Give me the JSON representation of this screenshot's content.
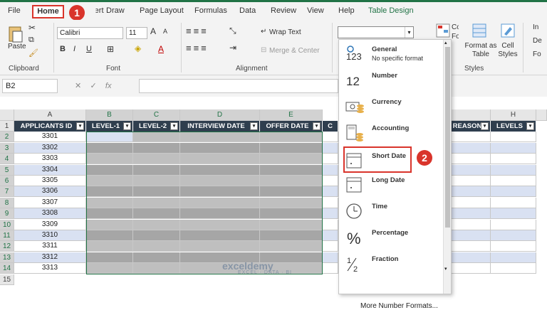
{
  "tabs": [
    "File",
    "Home",
    "Insert",
    "Draw",
    "Page Layout",
    "Formulas",
    "Data",
    "Review",
    "View",
    "Help",
    "Table Design"
  ],
  "annotations": {
    "step1": "1",
    "step2": "2"
  },
  "ribbon": {
    "clipboard": {
      "paste": "Paste",
      "label": "Clipboard"
    },
    "font": {
      "name": "Calibri",
      "size": "11",
      "label": "Font",
      "bold": "B",
      "italic": "I",
      "underline": "U",
      "increase": "A",
      "decrease": "A"
    },
    "alignment": {
      "wrap": "Wrap Text",
      "merge": "Merge & Center",
      "label": "Alignment"
    },
    "styles": {
      "conditional": "Conditional Formatting",
      "format_as_table": "Format as Table",
      "cell_styles": "Cell Styles",
      "label": "Styles"
    },
    "cells": {
      "insert": "In",
      "delete": "De",
      "format": "Fo"
    }
  },
  "formula_bar": {
    "name_box": "B2",
    "fx": "fx"
  },
  "grid": {
    "columns": [
      "A",
      "B",
      "C",
      "D",
      "E",
      "H"
    ],
    "headers": [
      "APPLICANTS ID",
      "LEVEL-1",
      "LEVEL-2",
      "INTERVIEW DATE",
      "OFFER DATE",
      "C",
      "REASON",
      "LEVELS"
    ],
    "row_numbers": [
      "1",
      "2",
      "3",
      "4",
      "5",
      "6",
      "7",
      "8",
      "9",
      "10",
      "11",
      "12",
      "13",
      "14",
      "15"
    ],
    "ids": [
      "3301",
      "3302",
      "3303",
      "3304",
      "3305",
      "3306",
      "3307",
      "3308",
      "3309",
      "3310",
      "3311",
      "3312",
      "3313"
    ]
  },
  "number_format_menu": {
    "items": [
      {
        "title": "General",
        "sub": "No specific format",
        "icon": "general-123-icon"
      },
      {
        "title": "Number",
        "sub": "",
        "icon": "number-12-icon"
      },
      {
        "title": "Currency",
        "sub": "",
        "icon": "currency-icon"
      },
      {
        "title": "Accounting",
        "sub": "",
        "icon": "accounting-icon"
      },
      {
        "title": "Short Date",
        "sub": "",
        "icon": "short-date-icon"
      },
      {
        "title": "Long Date",
        "sub": "",
        "icon": "long-date-icon"
      },
      {
        "title": "Time",
        "sub": "",
        "icon": "clock-icon"
      },
      {
        "title": "Percentage",
        "sub": "",
        "icon": "percent-icon"
      },
      {
        "title": "Fraction",
        "sub": "",
        "icon": "fraction-icon"
      }
    ],
    "more": "More Number Formats..."
  },
  "watermark": {
    "name": "exceldemy",
    "tagline": "EXCEL · DATA · BI"
  },
  "colors": {
    "accent": "#217346",
    "highlight": "#d9342b",
    "header": "#2f3e4e",
    "band": "#d9e1f2"
  }
}
